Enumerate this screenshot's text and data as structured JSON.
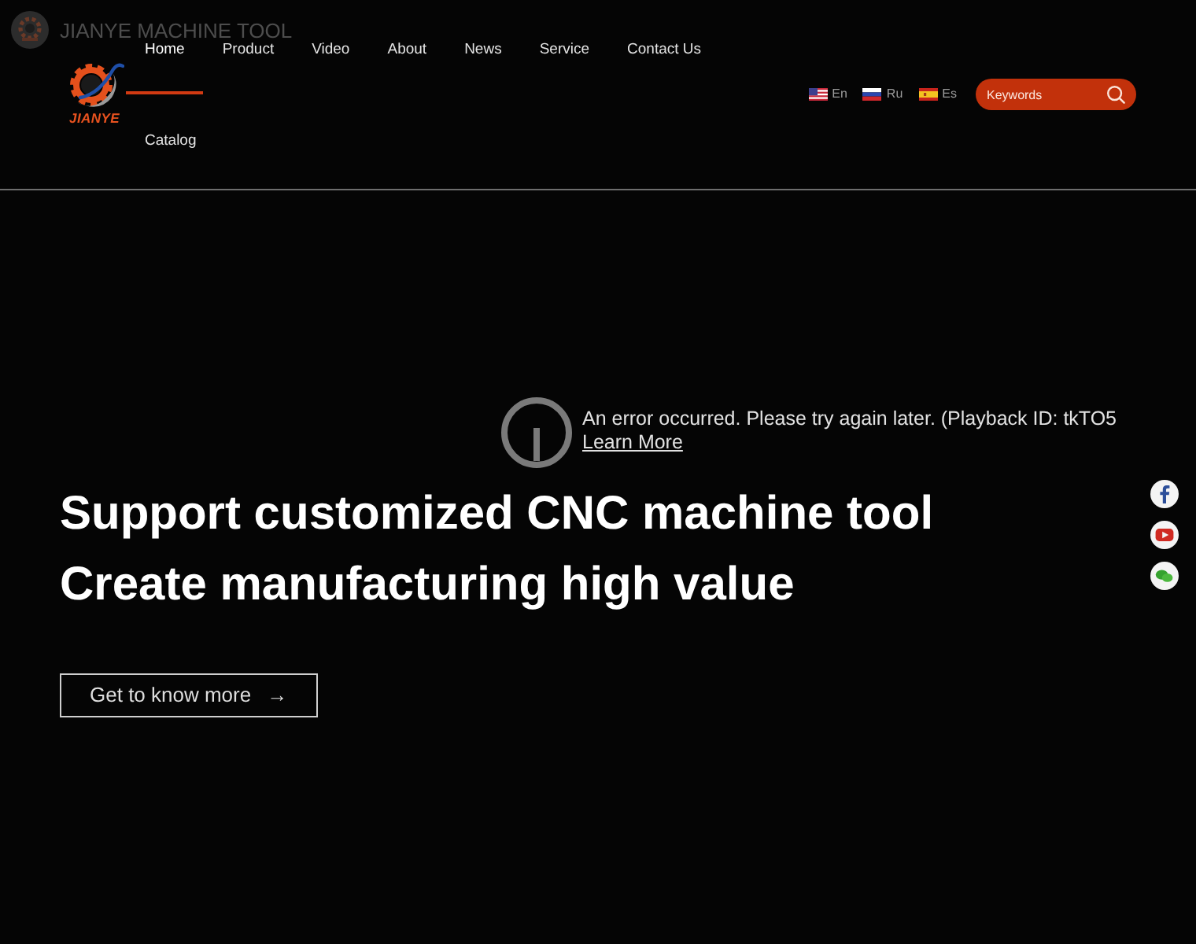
{
  "video_overlay": {
    "channel_title": "JIANYE MACHINE TOOL",
    "error_message": "An error occurred. Please try again later. (Playback ID: tkTO5",
    "learn_more": "Learn More"
  },
  "header": {
    "logo_text": "JIANYE",
    "nav": [
      {
        "label": "Home",
        "selected": true
      },
      {
        "label": "Product",
        "selected": false
      },
      {
        "label": "Video",
        "selected": false
      },
      {
        "label": "About",
        "selected": false
      },
      {
        "label": "News",
        "selected": false
      },
      {
        "label": "Service",
        "selected": false
      },
      {
        "label": "Contact Us",
        "selected": false
      },
      {
        "label": "Catalog",
        "selected": false
      }
    ],
    "languages": [
      {
        "kind": "us",
        "label": "En"
      },
      {
        "kind": "ru",
        "label": "Ru"
      },
      {
        "kind": "es",
        "label": "Es"
      }
    ],
    "search": {
      "placeholder": "Keywords"
    }
  },
  "hero": {
    "headline": [
      "Support customized CNC machine tool",
      "Create manufacturing high value"
    ],
    "button": {
      "label": "Get to know more",
      "arrow": "→"
    }
  },
  "social": [
    {
      "kind": "facebook"
    },
    {
      "kind": "youtube"
    },
    {
      "kind": "wechat"
    }
  ]
}
